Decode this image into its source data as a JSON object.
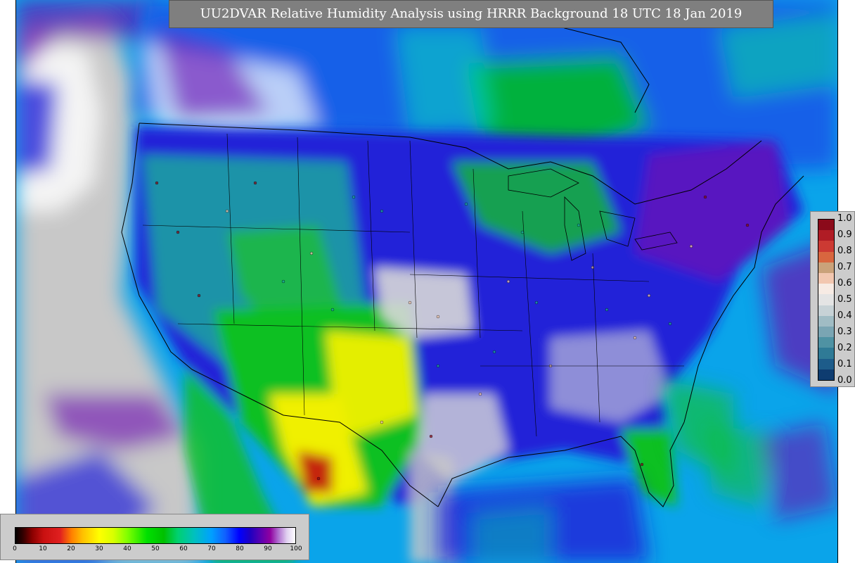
{
  "title": "UU2DVAR Relative Humidity Analysis using HRRR Background 18 UTC 18 Jan 2019",
  "observation_legend": {
    "ticks": [
      "1.0",
      "0.9",
      "0.8",
      "0.7",
      "0.6",
      "0.5",
      "0.4",
      "0.3",
      "0.2",
      "0.1",
      "0.0"
    ],
    "colors": [
      "#8b0a1a",
      "#b01c25",
      "#cc3a33",
      "#d8663f",
      "#caa27a",
      "#f2c7b0",
      "#f7ebe4",
      "#e4e4e4",
      "#c7d2d6",
      "#a0bcc4",
      "#7aa5b3",
      "#4f92a3",
      "#2f7a96",
      "#1d5c8a",
      "#0e3c70"
    ]
  },
  "rh_legend": {
    "ticks": [
      "0",
      "10",
      "20",
      "30",
      "40",
      "50",
      "60",
      "70",
      "80",
      "90",
      "100"
    ]
  },
  "map": {
    "colors": {
      "ocean": "#00a6ec",
      "deep_ocean": "#0a60e8",
      "moist": "#2020d8",
      "very_moist": "#ffffff",
      "saturated_grey": "#c8c8c8",
      "purple": "#6a0cb0",
      "green": "#10c020",
      "teal": "#1aa8a0",
      "yellow": "#f0f000",
      "dry_red": "#b01010",
      "border": "#000000"
    }
  }
}
